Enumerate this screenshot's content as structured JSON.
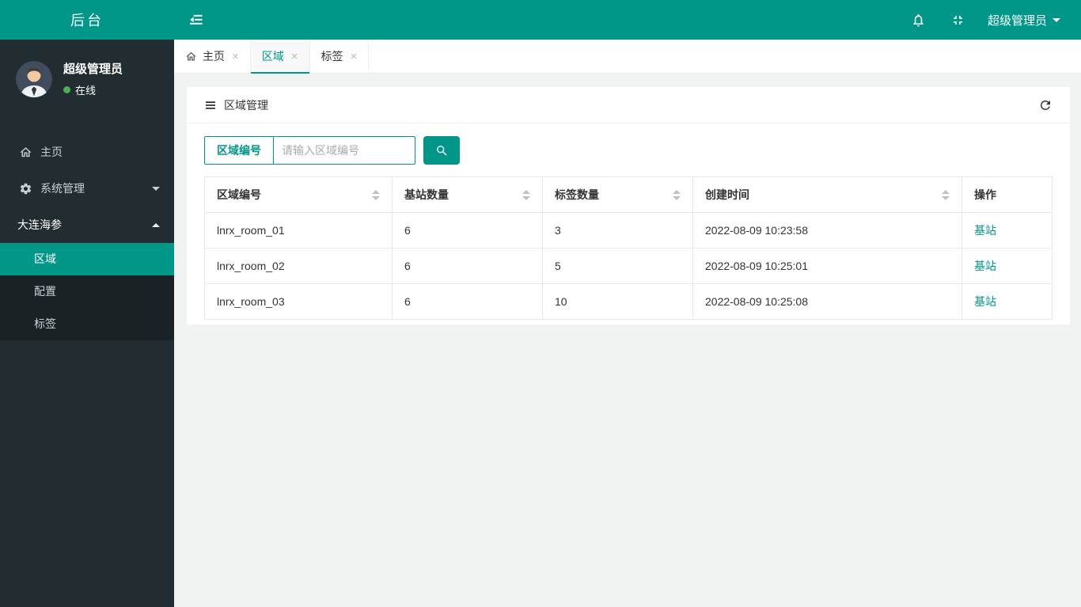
{
  "colors": {
    "primary": "#009688",
    "sidebar_bg": "#222d32",
    "submenu_bg": "#1a2226",
    "page_bg": "#f1f3f3",
    "link": "#009688",
    "online_dot": "#4caf50"
  },
  "header": {
    "logo": "后台",
    "username": "超级管理员"
  },
  "sidebar": {
    "profile": {
      "name": "超级管理员",
      "status": "在线"
    },
    "items": [
      {
        "label": "主页",
        "icon": "home-icon"
      },
      {
        "label": "系统管理",
        "icon": "gear-icon",
        "caret": "down"
      },
      {
        "label": "大连海参",
        "icon": null,
        "caret": "up"
      }
    ],
    "submenu": [
      {
        "label": "区域",
        "active": true
      },
      {
        "label": "配置",
        "active": false
      },
      {
        "label": "标签",
        "active": false
      }
    ]
  },
  "tabs": [
    {
      "label": "主页",
      "icon": "home-icon",
      "active": false
    },
    {
      "label": "区域",
      "icon": null,
      "active": true
    },
    {
      "label": "标签",
      "icon": null,
      "active": false
    }
  ],
  "icons": {
    "close": "×"
  },
  "panel": {
    "title": "区域管理",
    "search_label": "区域编号",
    "search_placeholder": "请输入区域编号",
    "search_value": ""
  },
  "table": {
    "columns": [
      "区域编号",
      "基站数量",
      "标签数量",
      "创建时间",
      "操作"
    ],
    "rows": [
      {
        "region": "lnrx_room_01",
        "stations": "6",
        "tags": "3",
        "created": "2022-08-09 10:23:58",
        "action": "基站"
      },
      {
        "region": "lnrx_room_02",
        "stations": "6",
        "tags": "5",
        "created": "2022-08-09 10:25:01",
        "action": "基站"
      },
      {
        "region": "lnrx_room_03",
        "stations": "6",
        "tags": "10",
        "created": "2022-08-09 10:25:08",
        "action": "基站"
      }
    ]
  }
}
